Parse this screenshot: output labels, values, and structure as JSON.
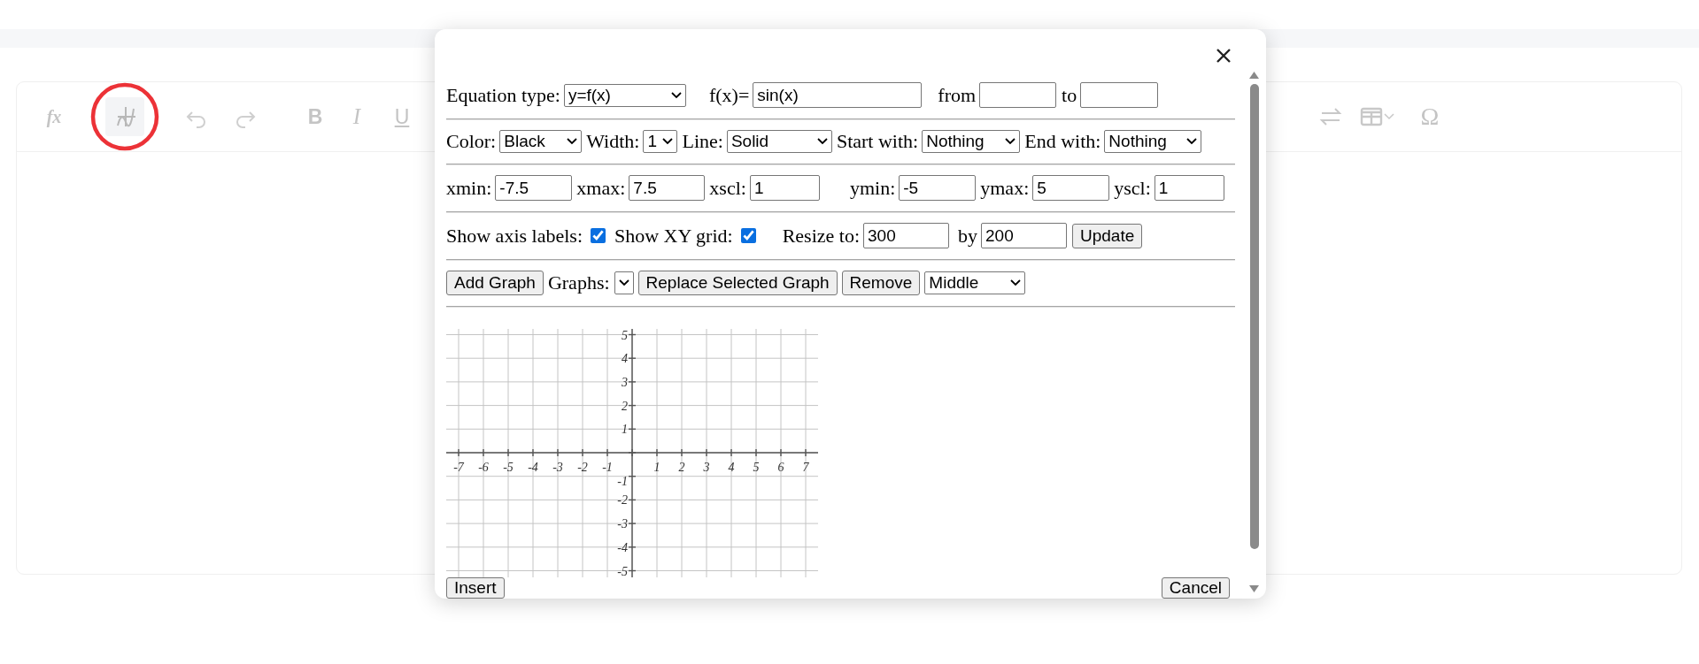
{
  "toolbar": {
    "left_items": [
      {
        "kind": "text",
        "label": "fx",
        "selected": false
      },
      {
        "kind": "graph",
        "selected": true
      },
      {
        "kind": "undo",
        "selected": false
      },
      {
        "kind": "redo",
        "selected": false
      },
      {
        "kind": "text",
        "label": "B",
        "selected": false
      },
      {
        "kind": "italic",
        "label": "I",
        "selected": false
      },
      {
        "kind": "underline",
        "label": "U",
        "selected": false
      }
    ],
    "right_items": [
      {
        "kind": "swap",
        "selected": false
      },
      {
        "kind": "table",
        "selected": false
      },
      {
        "kind": "text",
        "label": "Ω",
        "selected": false
      }
    ]
  },
  "dialog": {
    "sections": [
      {
        "controls": [
          {
            "kind": "label",
            "text": "Equation type:"
          },
          {
            "kind": "select",
            "value": "y=f(x)"
          },
          {
            "kind": "label",
            "text": "f(x)="
          },
          {
            "kind": "input",
            "value": "sin(x)"
          },
          {
            "kind": "label",
            "text": "from"
          },
          {
            "kind": "input"
          },
          {
            "kind": "label",
            "text": "to"
          },
          {
            "kind": "input"
          }
        ]
      },
      {
        "controls": [
          {
            "kind": "label",
            "text": "Color:"
          },
          {
            "kind": "select",
            "value": "Black"
          },
          {
            "kind": "label",
            "text": "Width:"
          },
          {
            "kind": "select",
            "value": "1"
          },
          {
            "kind": "label",
            "text": "Line:"
          },
          {
            "kind": "select",
            "value": "Solid"
          },
          {
            "kind": "label",
            "text": "Start with:"
          },
          {
            "kind": "select",
            "value": "Nothing"
          },
          {
            "kind": "label",
            "text": "End with:"
          },
          {
            "kind": "select",
            "value": "Nothing"
          }
        ]
      },
      {
        "controls": [
          {
            "kind": "label",
            "text": "xmin:"
          },
          {
            "kind": "input",
            "value": "-7.5"
          },
          {
            "kind": "label",
            "text": "xmax:"
          },
          {
            "kind": "input",
            "value": "7.5"
          },
          {
            "kind": "label",
            "text": "xscl:"
          },
          {
            "kind": "input",
            "value": "1"
          },
          {
            "kind": "label",
            "text": "ymin:"
          },
          {
            "kind": "input",
            "value": "-5"
          },
          {
            "kind": "label",
            "text": "ymax:"
          },
          {
            "kind": "input",
            "value": "5"
          },
          {
            "kind": "label",
            "text": "yscl:"
          },
          {
            "kind": "input",
            "value": "1"
          }
        ]
      },
      {
        "controls": [
          {
            "kind": "label",
            "text": "Show axis labels:"
          },
          {
            "kind": "checkbox",
            "checked": true
          },
          {
            "kind": "label",
            "text": "Show XY grid:"
          },
          {
            "kind": "checkbox",
            "checked": true
          },
          {
            "kind": "label",
            "text": "Resize to:"
          },
          {
            "kind": "input",
            "value": "300"
          },
          {
            "kind": "label",
            "text": "by"
          },
          {
            "kind": "input",
            "value": "200"
          },
          {
            "kind": "button",
            "text": "Update"
          }
        ]
      },
      {
        "controls": [
          {
            "kind": "button",
            "text": "Add Graph"
          },
          {
            "kind": "label",
            "text": "Graphs:"
          },
          {
            "kind": "select"
          },
          {
            "kind": "button",
            "text": "Replace Selected Graph"
          },
          {
            "kind": "button",
            "text": "Remove"
          },
          {
            "kind": "select",
            "value": "Middle"
          }
        ]
      }
    ],
    "graph": {
      "x_labels": [
        "-7",
        "-6",
        "-5",
        "-4",
        "-3",
        "-2",
        "-1",
        "1",
        "2",
        "3",
        "4",
        "5",
        "6",
        "7"
      ],
      "y_labels": [
        "5",
        "4",
        "3",
        "2",
        "1",
        "-1",
        "-2",
        "-3",
        "-4",
        "-5"
      ]
    },
    "buttons": [
      {
        "text": "Insert"
      },
      {
        "text": "Cancel"
      }
    ]
  }
}
